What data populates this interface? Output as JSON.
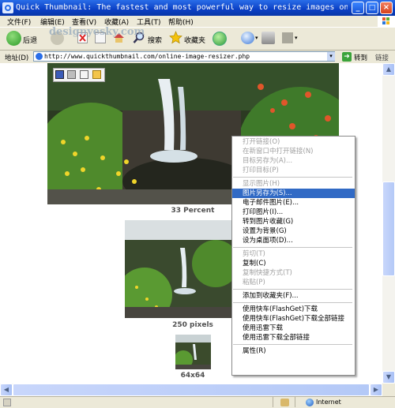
{
  "window": {
    "title": "Quick Thumbnail: The fastest and most powerful way to resize images onlin...",
    "controls": {
      "minimize": "_",
      "maximize": "□",
      "close": "×"
    }
  },
  "menu": [
    "文件(F)",
    "编辑(E)",
    "查看(V)",
    "收藏(A)",
    "工具(T)",
    "帮助(H)"
  ],
  "toolbar": {
    "back_label": "后退",
    "search_label": "搜索",
    "favorites_label": "收藏夹",
    "watermark": "designyesky.com"
  },
  "address": {
    "label": "地址(D)",
    "url": "http://www.quickthumbnail.com/online-image-resizer.php",
    "go_label": "转到",
    "links_label": "链接"
  },
  "captions": {
    "percent": "33 Percent",
    "pixels": "250 pixels",
    "square": "64x64"
  },
  "context_menu": [
    {
      "label": "打开链接(O)",
      "state": "disabled"
    },
    {
      "label": "在新窗口中打开链接(N)",
      "state": "disabled"
    },
    {
      "label": "目标另存为(A)...",
      "state": "disabled"
    },
    {
      "label": "打印目标(P)",
      "state": "disabled"
    },
    {
      "sep": true
    },
    {
      "label": "显示图片(H)",
      "state": "disabled"
    },
    {
      "label": "图片另存为(S)...",
      "state": "highlighted"
    },
    {
      "label": "电子邮件图片(E)...",
      "state": "normal"
    },
    {
      "label": "打印图片(I)...",
      "state": "normal"
    },
    {
      "label": "转到图片收藏(G)",
      "state": "normal"
    },
    {
      "label": "设置为背景(G)",
      "state": "normal"
    },
    {
      "label": "设为桌面项(D)...",
      "state": "normal"
    },
    {
      "sep": true
    },
    {
      "label": "剪切(T)",
      "state": "disabled"
    },
    {
      "label": "复制(C)",
      "state": "normal"
    },
    {
      "label": "复制快捷方式(T)",
      "state": "disabled"
    },
    {
      "label": "粘贴(P)",
      "state": "disabled"
    },
    {
      "sep": true
    },
    {
      "label": "添加到收藏夹(F)...",
      "state": "normal"
    },
    {
      "sep": true
    },
    {
      "label": "使用快车(FlashGet)下载",
      "state": "normal"
    },
    {
      "label": "使用快车(FlashGet)下载全部链接",
      "state": "normal"
    },
    {
      "label": "使用迅雷下载",
      "state": "normal"
    },
    {
      "label": "使用迅雷下载全部链接",
      "state": "normal"
    },
    {
      "sep": true
    },
    {
      "label": "属性(R)",
      "state": "normal"
    }
  ],
  "status": {
    "zone": "Internet"
  },
  "colors": {
    "titlebar": "#0a3fc4",
    "highlight": "#316ac5",
    "menu_bg": "#ece9d8"
  }
}
